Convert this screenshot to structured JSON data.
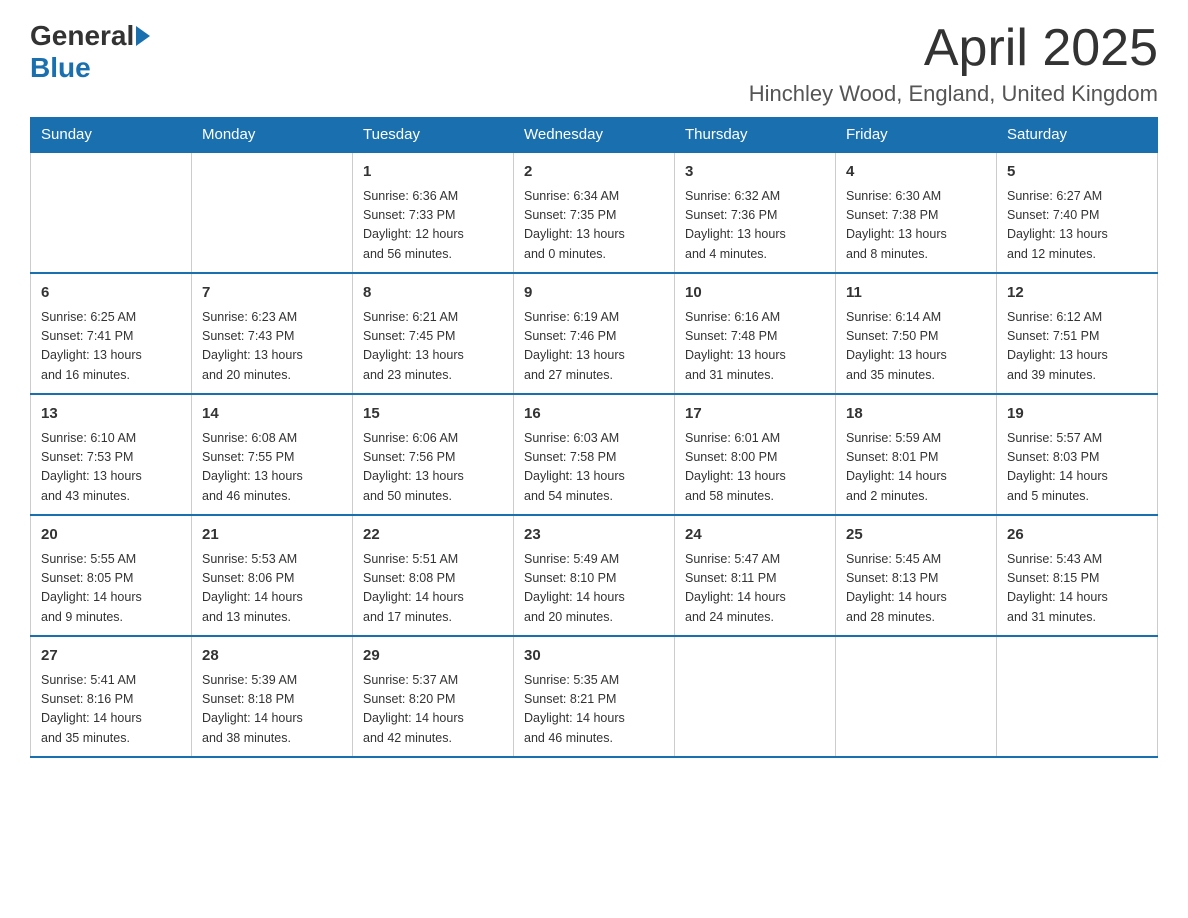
{
  "header": {
    "logo_general": "General",
    "logo_blue": "Blue",
    "month_title": "April 2025",
    "location": "Hinchley Wood, England, United Kingdom"
  },
  "calendar": {
    "days_of_week": [
      "Sunday",
      "Monday",
      "Tuesday",
      "Wednesday",
      "Thursday",
      "Friday",
      "Saturday"
    ],
    "weeks": [
      [
        {
          "day": "",
          "info": ""
        },
        {
          "day": "",
          "info": ""
        },
        {
          "day": "1",
          "info": "Sunrise: 6:36 AM\nSunset: 7:33 PM\nDaylight: 12 hours\nand 56 minutes."
        },
        {
          "day": "2",
          "info": "Sunrise: 6:34 AM\nSunset: 7:35 PM\nDaylight: 13 hours\nand 0 minutes."
        },
        {
          "day": "3",
          "info": "Sunrise: 6:32 AM\nSunset: 7:36 PM\nDaylight: 13 hours\nand 4 minutes."
        },
        {
          "day": "4",
          "info": "Sunrise: 6:30 AM\nSunset: 7:38 PM\nDaylight: 13 hours\nand 8 minutes."
        },
        {
          "day": "5",
          "info": "Sunrise: 6:27 AM\nSunset: 7:40 PM\nDaylight: 13 hours\nand 12 minutes."
        }
      ],
      [
        {
          "day": "6",
          "info": "Sunrise: 6:25 AM\nSunset: 7:41 PM\nDaylight: 13 hours\nand 16 minutes."
        },
        {
          "day": "7",
          "info": "Sunrise: 6:23 AM\nSunset: 7:43 PM\nDaylight: 13 hours\nand 20 minutes."
        },
        {
          "day": "8",
          "info": "Sunrise: 6:21 AM\nSunset: 7:45 PM\nDaylight: 13 hours\nand 23 minutes."
        },
        {
          "day": "9",
          "info": "Sunrise: 6:19 AM\nSunset: 7:46 PM\nDaylight: 13 hours\nand 27 minutes."
        },
        {
          "day": "10",
          "info": "Sunrise: 6:16 AM\nSunset: 7:48 PM\nDaylight: 13 hours\nand 31 minutes."
        },
        {
          "day": "11",
          "info": "Sunrise: 6:14 AM\nSunset: 7:50 PM\nDaylight: 13 hours\nand 35 minutes."
        },
        {
          "day": "12",
          "info": "Sunrise: 6:12 AM\nSunset: 7:51 PM\nDaylight: 13 hours\nand 39 minutes."
        }
      ],
      [
        {
          "day": "13",
          "info": "Sunrise: 6:10 AM\nSunset: 7:53 PM\nDaylight: 13 hours\nand 43 minutes."
        },
        {
          "day": "14",
          "info": "Sunrise: 6:08 AM\nSunset: 7:55 PM\nDaylight: 13 hours\nand 46 minutes."
        },
        {
          "day": "15",
          "info": "Sunrise: 6:06 AM\nSunset: 7:56 PM\nDaylight: 13 hours\nand 50 minutes."
        },
        {
          "day": "16",
          "info": "Sunrise: 6:03 AM\nSunset: 7:58 PM\nDaylight: 13 hours\nand 54 minutes."
        },
        {
          "day": "17",
          "info": "Sunrise: 6:01 AM\nSunset: 8:00 PM\nDaylight: 13 hours\nand 58 minutes."
        },
        {
          "day": "18",
          "info": "Sunrise: 5:59 AM\nSunset: 8:01 PM\nDaylight: 14 hours\nand 2 minutes."
        },
        {
          "day": "19",
          "info": "Sunrise: 5:57 AM\nSunset: 8:03 PM\nDaylight: 14 hours\nand 5 minutes."
        }
      ],
      [
        {
          "day": "20",
          "info": "Sunrise: 5:55 AM\nSunset: 8:05 PM\nDaylight: 14 hours\nand 9 minutes."
        },
        {
          "day": "21",
          "info": "Sunrise: 5:53 AM\nSunset: 8:06 PM\nDaylight: 14 hours\nand 13 minutes."
        },
        {
          "day": "22",
          "info": "Sunrise: 5:51 AM\nSunset: 8:08 PM\nDaylight: 14 hours\nand 17 minutes."
        },
        {
          "day": "23",
          "info": "Sunrise: 5:49 AM\nSunset: 8:10 PM\nDaylight: 14 hours\nand 20 minutes."
        },
        {
          "day": "24",
          "info": "Sunrise: 5:47 AM\nSunset: 8:11 PM\nDaylight: 14 hours\nand 24 minutes."
        },
        {
          "day": "25",
          "info": "Sunrise: 5:45 AM\nSunset: 8:13 PM\nDaylight: 14 hours\nand 28 minutes."
        },
        {
          "day": "26",
          "info": "Sunrise: 5:43 AM\nSunset: 8:15 PM\nDaylight: 14 hours\nand 31 minutes."
        }
      ],
      [
        {
          "day": "27",
          "info": "Sunrise: 5:41 AM\nSunset: 8:16 PM\nDaylight: 14 hours\nand 35 minutes."
        },
        {
          "day": "28",
          "info": "Sunrise: 5:39 AM\nSunset: 8:18 PM\nDaylight: 14 hours\nand 38 minutes."
        },
        {
          "day": "29",
          "info": "Sunrise: 5:37 AM\nSunset: 8:20 PM\nDaylight: 14 hours\nand 42 minutes."
        },
        {
          "day": "30",
          "info": "Sunrise: 5:35 AM\nSunset: 8:21 PM\nDaylight: 14 hours\nand 46 minutes."
        },
        {
          "day": "",
          "info": ""
        },
        {
          "day": "",
          "info": ""
        },
        {
          "day": "",
          "info": ""
        }
      ]
    ]
  }
}
